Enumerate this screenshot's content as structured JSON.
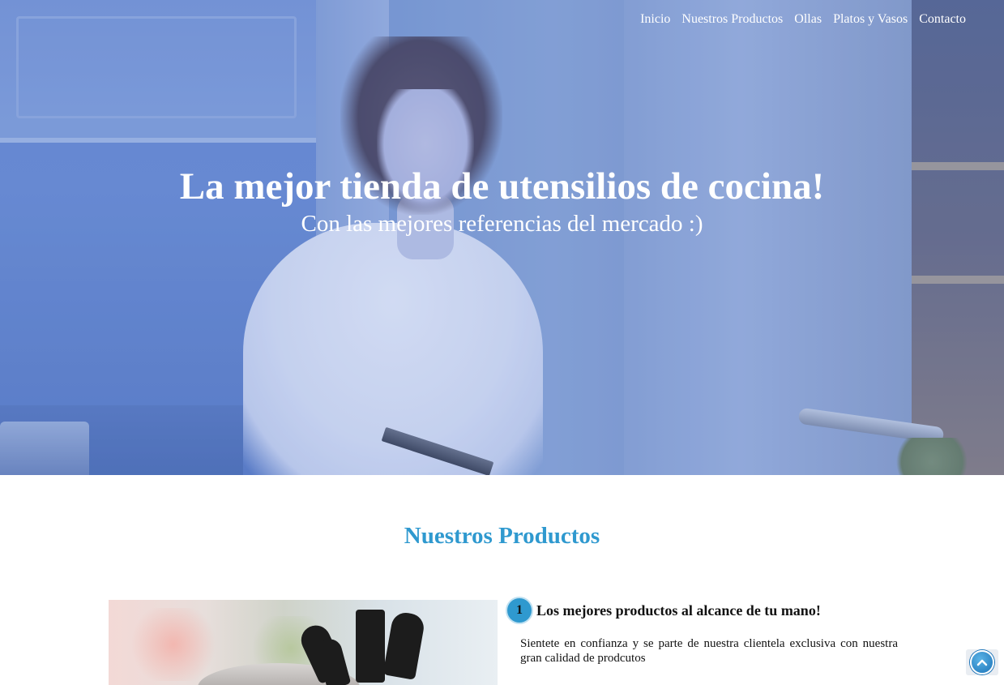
{
  "nav": {
    "items": [
      {
        "label": "Inicio"
      },
      {
        "label": "Nuestros Productos"
      },
      {
        "label": "Ollas"
      },
      {
        "label": "Platos y Vasos"
      },
      {
        "label": "Contacto"
      }
    ]
  },
  "hero": {
    "title": "La mejor tienda de utensilios de cocina!",
    "subtitle": "Con las mejores referencias del mercado :)"
  },
  "products": {
    "section_title": "Nuestros Productos",
    "feature": {
      "number": "1",
      "title": "Los mejores productos al alcance de tu mano!",
      "text": "Sientete en confianza y se parte de nuestra clientela exclusiva con nuestra gran calidad de prodcutos"
    }
  },
  "colors": {
    "accent": "#2f99cf",
    "hero_overlay": "#6a8ad0",
    "text": "#111111"
  },
  "icons": {
    "scroll_top": "chevron-up-circle-icon"
  }
}
